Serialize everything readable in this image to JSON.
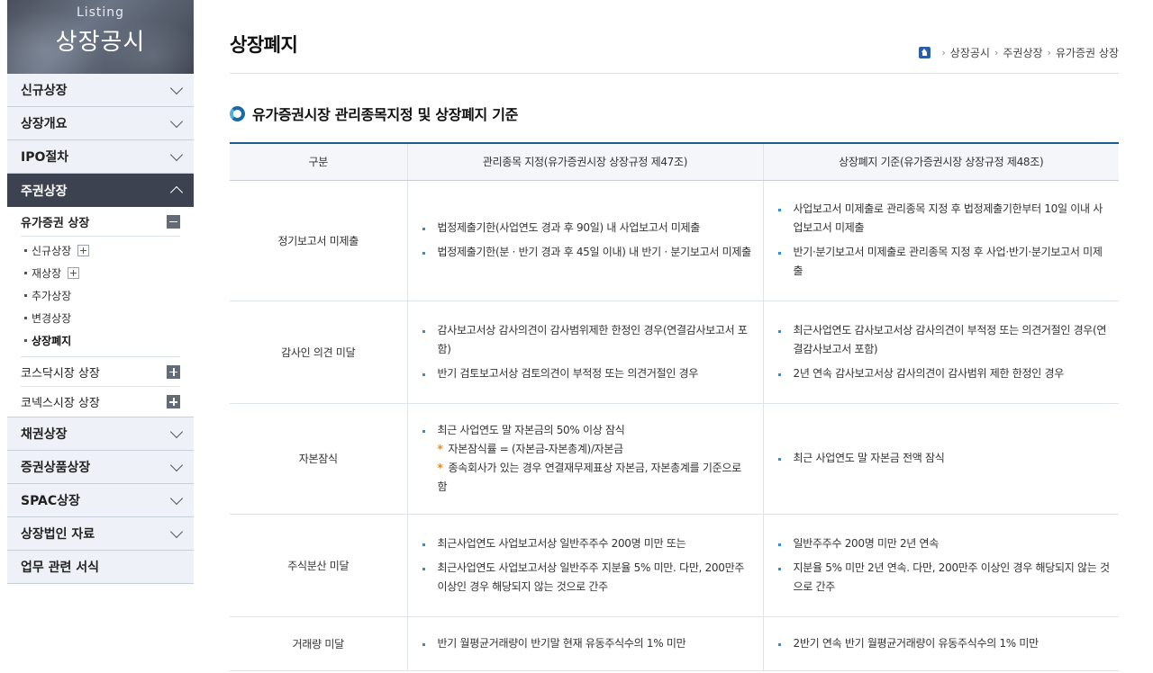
{
  "sidebar": {
    "banner_sub": "Listing",
    "banner_title": "상장공시",
    "menu": [
      {
        "label": "신규상장"
      },
      {
        "label": "상장개요"
      },
      {
        "label": "IPO절차"
      },
      {
        "label": "주권상장"
      },
      {
        "label": "채권상장"
      },
      {
        "label": "증권상품상장"
      },
      {
        "label": "SPAC상장"
      },
      {
        "label": "상장법인 자료"
      },
      {
        "label": "업무 관련 서식"
      }
    ],
    "submenu": {
      "head": "유가증권 상장",
      "items": [
        {
          "label": "신규상장"
        },
        {
          "label": "재상장"
        },
        {
          "label": "추가상장"
        },
        {
          "label": "변경상장"
        },
        {
          "label": "상장폐지"
        }
      ],
      "others": [
        {
          "label": "코스닥시장 상장"
        },
        {
          "label": "코넥스시장 상장"
        }
      ]
    }
  },
  "page": {
    "title": "상장폐지",
    "breadcrumb": [
      "상장공시",
      "주권상장",
      "유가증권 상장"
    ],
    "section_title": "유가증권시장 관리종목지정 및 상장폐지 기준"
  },
  "table": {
    "headers": [
      "구분",
      "관리종목 지정(유가증권시장 상장규정 제47조)",
      "상장폐지 기준(유가증권시장 상장규정 제48조)"
    ],
    "rows": [
      {
        "category": "정기보고서 미제출",
        "designation": [
          "법정제출기한(사업연도 경과 후 90일) 내 사업보고서 미제출",
          "법정제출기한(분 · 반기 경과 후 45일 이내) 내 반기 · 분기보고서 미제출"
        ],
        "delisting": [
          "사업보고서 미제출로 관리종목 지정 후 법정제출기한부터 10일 이내 사업보고서 미제출",
          "반기·분기보고서 미제출로 관리종목 지정 후 사업·반기·분기보고서 미제출"
        ]
      },
      {
        "category": "감사인 의견 미달",
        "designation": [
          "감사보고서상 감사의견이 감사범위제한 한정인 경우(연결감사보고서 포함)",
          "반기 검토보고서상 검토의견이 부적정 또는 의견거절인 경우"
        ],
        "delisting": [
          "최근사업연도 감사보고서상 감사의견이 부적정 또는 의견거절인 경우(연결감사보고서 포함)",
          "2년 연속 감사보고서상 감사의견이 감사범위 제한 한정인 경우"
        ]
      },
      {
        "category": "자본잠식",
        "designation_main": "최근 사업연도 말 자본금의 50% 이상 잠식",
        "designation_notes": [
          "자본잠식률 = (자본금-자본총계)/자본금",
          "종속회사가 있는 경우 연결재무제표상 자본금, 자본총계를 기준으로 함"
        ],
        "delisting": [
          "최근 사업연도 말 자본금 전액 잠식"
        ]
      },
      {
        "category": "주식분산 미달",
        "designation": [
          "최근사업연도 사업보고서상 일반주주수  200명 미만 또는",
          "최근사업연도 사업보고서상 일반주주 지분율 5% 미만. 다만, 200만주 이상인 경우 해당되지 않는 것으로 간주"
        ],
        "delisting": [
          "일반주주수 200명 미만 2년 연속",
          "지분율 5% 미만 2년 연속. 다만, 200만주 이상인 경우 해당되지 않는 것으로 간주"
        ]
      },
      {
        "category": "거래량 미달",
        "designation": [
          "반기 월평균거래량이 반기말 현재 유동주식수의 1% 미만"
        ],
        "delisting": [
          "2반기 연속 반기 월평균거래량이 유동주식수의 1% 미만"
        ]
      }
    ]
  }
}
